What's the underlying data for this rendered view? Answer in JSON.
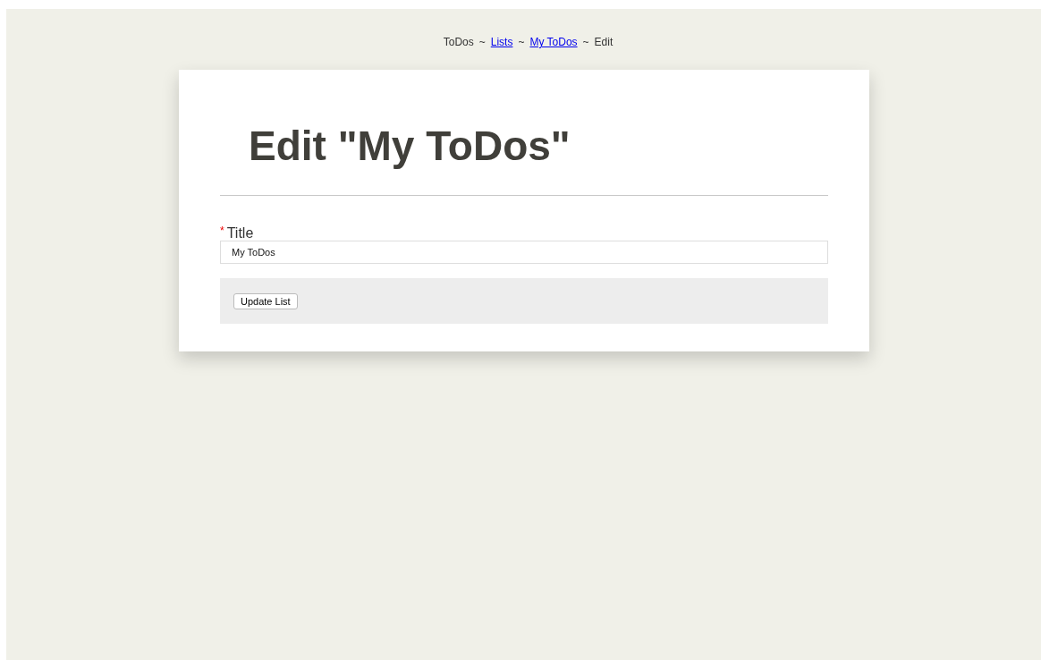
{
  "breadcrumb": [
    {
      "kind": "text",
      "label": "ToDos"
    },
    {
      "kind": "sep",
      "label": "~"
    },
    {
      "kind": "link",
      "label": "Lists"
    },
    {
      "kind": "sep",
      "label": "~"
    },
    {
      "kind": "link",
      "label": "My ToDos"
    },
    {
      "kind": "sep",
      "label": "~"
    },
    {
      "kind": "text",
      "label": "Edit"
    }
  ],
  "heading": "Edit \"My ToDos\"",
  "form": {
    "field": {
      "required_mark": "*",
      "label": "Title",
      "value": "My ToDos"
    },
    "submit": "Update List"
  }
}
